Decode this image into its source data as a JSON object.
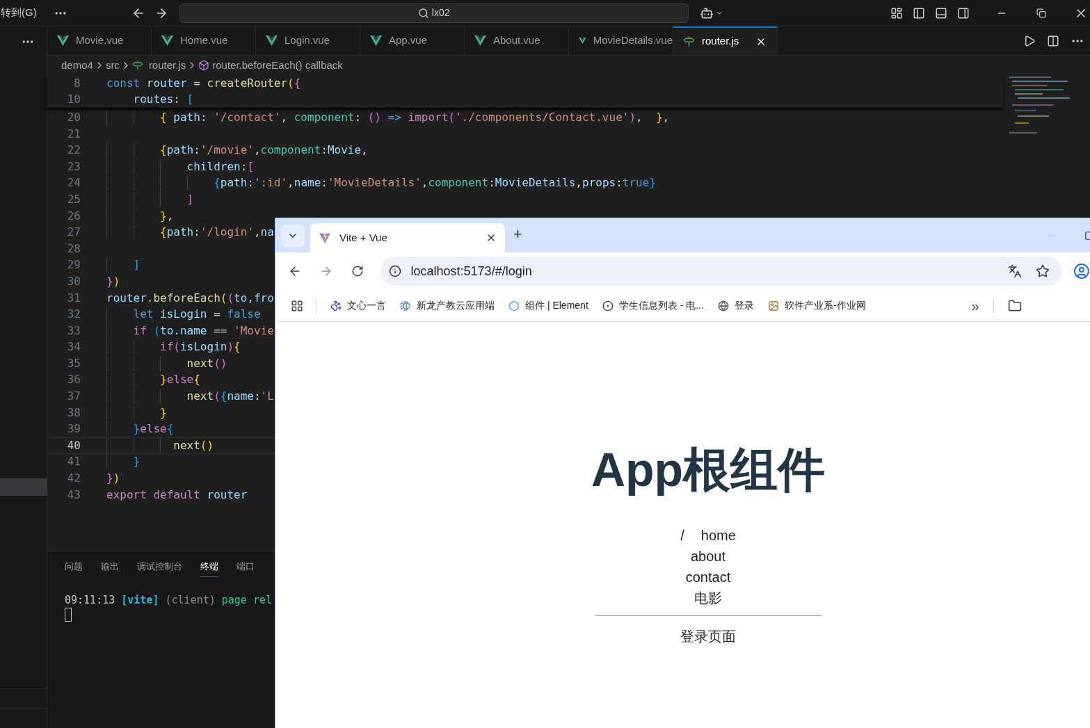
{
  "titlebar": {
    "menu": "转到(G)",
    "search": "lx02"
  },
  "tabs": [
    {
      "label": "Movie.vue",
      "kind": "vue",
      "selected": false
    },
    {
      "label": "Home.vue",
      "kind": "vue",
      "selected": false
    },
    {
      "label": "Login.vue",
      "kind": "vue",
      "selected": false
    },
    {
      "label": "App.vue",
      "kind": "vue",
      "selected": false
    },
    {
      "label": "About.vue",
      "kind": "vue",
      "selected": false
    },
    {
      "label": "MovieDetails.vue",
      "kind": "vue",
      "selected": false
    },
    {
      "label": "router.js",
      "kind": "js",
      "selected": true
    }
  ],
  "breadcrumb": [
    "demo4",
    "src",
    "router.js",
    "router.beforeEach() callback"
  ],
  "sticky_lines": [
    {
      "number": "8",
      "tokens": [
        {
          "kind": "kw",
          "text": "const"
        },
        {
          "kind": "var",
          "text": " router"
        },
        {
          "kind": "p",
          "text": " = "
        },
        {
          "kind": "fn",
          "text": "createRouter"
        },
        {
          "kind": "b1",
          "text": "("
        },
        {
          "kind": "b2",
          "text": "{"
        }
      ]
    },
    {
      "number": "10",
      "tokens": [
        {
          "kind": "var",
          "text": "    routes"
        },
        {
          "kind": "p",
          "text": ": "
        },
        {
          "kind": "b3",
          "text": "["
        }
      ]
    }
  ],
  "code_lines": [
    {
      "number": "20",
      "current": false,
      "tokens": [
        {
          "kind": "b1",
          "text": "        {"
        },
        {
          "kind": "var",
          "text": " path"
        },
        {
          "kind": "p",
          "text": ": "
        },
        {
          "kind": "str",
          "text": "'/contact'"
        },
        {
          "kind": "p",
          "text": ", "
        },
        {
          "kind": "cls",
          "text": "component"
        },
        {
          "kind": "p",
          "text": ": "
        },
        {
          "kind": "b2",
          "text": "()"
        },
        {
          "kind": "kw",
          "text": " => "
        },
        {
          "kind": "ctl",
          "text": "import"
        },
        {
          "kind": "b2",
          "text": "("
        },
        {
          "kind": "str",
          "text": "'./components/Contact.vue'"
        },
        {
          "kind": "b2",
          "text": ")"
        },
        {
          "kind": "p",
          "text": ","
        },
        {
          "kind": "b1",
          "text": "  }"
        },
        {
          "kind": "p",
          "text": ","
        }
      ]
    },
    {
      "number": "21",
      "current": false
    },
    {
      "number": "22",
      "current": false,
      "tokens": [
        {
          "kind": "b1",
          "text": "        {"
        },
        {
          "kind": "var",
          "text": "path"
        },
        {
          "kind": "p",
          "text": ":"
        },
        {
          "kind": "str",
          "text": "'/movie'"
        },
        {
          "kind": "p",
          "text": ","
        },
        {
          "kind": "cls",
          "text": "component"
        },
        {
          "kind": "p",
          "text": ":"
        },
        {
          "kind": "var",
          "text": "Movie"
        },
        {
          "kind": "p",
          "text": ","
        }
      ]
    },
    {
      "number": "23",
      "current": false,
      "tokens": [
        {
          "kind": "var",
          "text": "            children"
        },
        {
          "kind": "p",
          "text": ":"
        },
        {
          "kind": "b2",
          "text": "["
        }
      ]
    },
    {
      "number": "24",
      "current": false,
      "tokens": [
        {
          "kind": "b3",
          "text": "                {"
        },
        {
          "kind": "var",
          "text": "path"
        },
        {
          "kind": "p",
          "text": ":"
        },
        {
          "kind": "str",
          "text": "':id'"
        },
        {
          "kind": "p",
          "text": ","
        },
        {
          "kind": "var",
          "text": "name"
        },
        {
          "kind": "p",
          "text": ":"
        },
        {
          "kind": "str",
          "text": "'MovieDetails'"
        },
        {
          "kind": "p",
          "text": ","
        },
        {
          "kind": "cls",
          "text": "component"
        },
        {
          "kind": "p",
          "text": ":"
        },
        {
          "kind": "var",
          "text": "MovieDetails"
        },
        {
          "kind": "p",
          "text": ","
        },
        {
          "kind": "var",
          "text": "props"
        },
        {
          "kind": "p",
          "text": ":"
        },
        {
          "kind": "kw",
          "text": "true"
        },
        {
          "kind": "b3",
          "text": "}"
        }
      ]
    },
    {
      "number": "25",
      "current": false,
      "tokens": [
        {
          "kind": "b2",
          "text": "            ]"
        }
      ]
    },
    {
      "number": "26",
      "current": false,
      "tokens": [
        {
          "kind": "b1",
          "text": "        }"
        },
        {
          "kind": "p",
          "text": ","
        }
      ]
    },
    {
      "number": "27",
      "current": false,
      "tokens": [
        {
          "kind": "b1",
          "text": "        {"
        },
        {
          "kind": "var",
          "text": "path"
        },
        {
          "kind": "p",
          "text": ":"
        },
        {
          "kind": "str",
          "text": "'/login'"
        },
        {
          "kind": "p",
          "text": ","
        },
        {
          "kind": "var",
          "text": "na"
        }
      ]
    },
    {
      "number": "28",
      "current": false
    },
    {
      "number": "29",
      "current": false,
      "tokens": [
        {
          "kind": "b3",
          "text": "    ]"
        }
      ]
    },
    {
      "number": "30",
      "current": false,
      "tokens": [
        {
          "kind": "b2",
          "text": "}"
        },
        {
          "kind": "b1",
          "text": ")"
        }
      ]
    },
    {
      "number": "31",
      "current": false,
      "tokens": [
        {
          "kind": "var",
          "text": "router"
        },
        {
          "kind": "p",
          "text": "."
        },
        {
          "kind": "fn",
          "text": "beforeEach"
        },
        {
          "kind": "b1",
          "text": "("
        },
        {
          "kind": "b2",
          "text": "("
        },
        {
          "kind": "var",
          "text": "to"
        },
        {
          "kind": "p",
          "text": ","
        },
        {
          "kind": "var",
          "text": "fro"
        }
      ]
    },
    {
      "number": "32",
      "current": false,
      "tokens": [
        {
          "kind": "kw",
          "text": "    let"
        },
        {
          "kind": "var",
          "text": " isLogin"
        },
        {
          "kind": "p",
          "text": " = "
        },
        {
          "kind": "kw",
          "text": "false"
        }
      ]
    },
    {
      "number": "33",
      "current": false,
      "tokens": [
        {
          "kind": "ctl",
          "text": "    if"
        },
        {
          "kind": "b3",
          "text": " ("
        },
        {
          "kind": "var",
          "text": "to"
        },
        {
          "kind": "p",
          "text": "."
        },
        {
          "kind": "var",
          "text": "name"
        },
        {
          "kind": "p",
          "text": " == "
        },
        {
          "kind": "str",
          "text": "'Movie"
        }
      ]
    },
    {
      "number": "34",
      "current": false,
      "tokens": [
        {
          "kind": "ctl",
          "text": "        if"
        },
        {
          "kind": "b2",
          "text": "("
        },
        {
          "kind": "var",
          "text": "isLogin"
        },
        {
          "kind": "b2",
          "text": ")"
        },
        {
          "kind": "b1",
          "text": "{"
        }
      ]
    },
    {
      "number": "35",
      "current": false,
      "tokens": [
        {
          "kind": "fn",
          "text": "            next"
        },
        {
          "kind": "b2",
          "text": "()"
        }
      ]
    },
    {
      "number": "36",
      "current": false,
      "tokens": [
        {
          "kind": "b1",
          "text": "        }"
        },
        {
          "kind": "ctl",
          "text": "else"
        },
        {
          "kind": "b1",
          "text": "{"
        }
      ]
    },
    {
      "number": "37",
      "current": false,
      "tokens": [
        {
          "kind": "fn",
          "text": "            next"
        },
        {
          "kind": "b2",
          "text": "("
        },
        {
          "kind": "b3",
          "text": "{"
        },
        {
          "kind": "var",
          "text": "name"
        },
        {
          "kind": "p",
          "text": ":"
        },
        {
          "kind": "str",
          "text": "'L"
        }
      ]
    },
    {
      "number": "38",
      "current": false,
      "tokens": [
        {
          "kind": "b1",
          "text": "        }"
        }
      ]
    },
    {
      "number": "39",
      "current": false,
      "tokens": [
        {
          "kind": "b3",
          "text": "    }"
        },
        {
          "kind": "ctl",
          "text": "else"
        },
        {
          "kind": "b3",
          "text": "{"
        }
      ]
    },
    {
      "number": "40",
      "current": true,
      "tokens": [
        {
          "kind": "fn",
          "text": "          next"
        },
        {
          "kind": "b1",
          "text": "()"
        }
      ]
    },
    {
      "number": "41",
      "current": false,
      "tokens": [
        {
          "kind": "b3",
          "text": "    }"
        }
      ]
    },
    {
      "number": "42",
      "current": false,
      "tokens": [
        {
          "kind": "b2",
          "text": "}"
        },
        {
          "kind": "b1",
          "text": ")"
        }
      ]
    },
    {
      "number": "43",
      "current": false,
      "tokens": [
        {
          "kind": "ctl",
          "text": "export default"
        },
        {
          "kind": "var",
          "text": " router"
        }
      ]
    }
  ],
  "panel": {
    "tabs": [
      {
        "label": "问题",
        "selected": false
      },
      {
        "label": "输出",
        "selected": false
      },
      {
        "label": "调试控制台",
        "selected": false
      },
      {
        "label": "终端",
        "selected": true
      },
      {
        "label": "端口",
        "selected": false
      }
    ],
    "terminal": {
      "time": "09:11:13",
      "tag": "[vite]",
      "source": "(client)",
      "message": "page rel"
    }
  },
  "browser": {
    "tab_title": "Vite + Vue",
    "new_tab": "+",
    "url": "localhost:5173/#/login",
    "bookmarks": [
      {
        "label": "文心一言",
        "kind": "paw"
      },
      {
        "label": "新龙产教云应用端",
        "kind": "fish"
      },
      {
        "label": "组件 | Element",
        "kind": "hexagon"
      },
      {
        "label": "学生信息列表 - 电...",
        "kind": "circle"
      },
      {
        "label": "登录",
        "kind": "globe"
      },
      {
        "label": "软件产业系-作业网",
        "kind": "image"
      }
    ],
    "more": "»",
    "page": {
      "heading": "App根组件",
      "nav": [
        {
          "prefix": "/",
          "label": "home"
        },
        {
          "label": "about"
        },
        {
          "label": "contact"
        },
        {
          "label": "电影"
        }
      ],
      "view_text": "登录页面"
    }
  }
}
